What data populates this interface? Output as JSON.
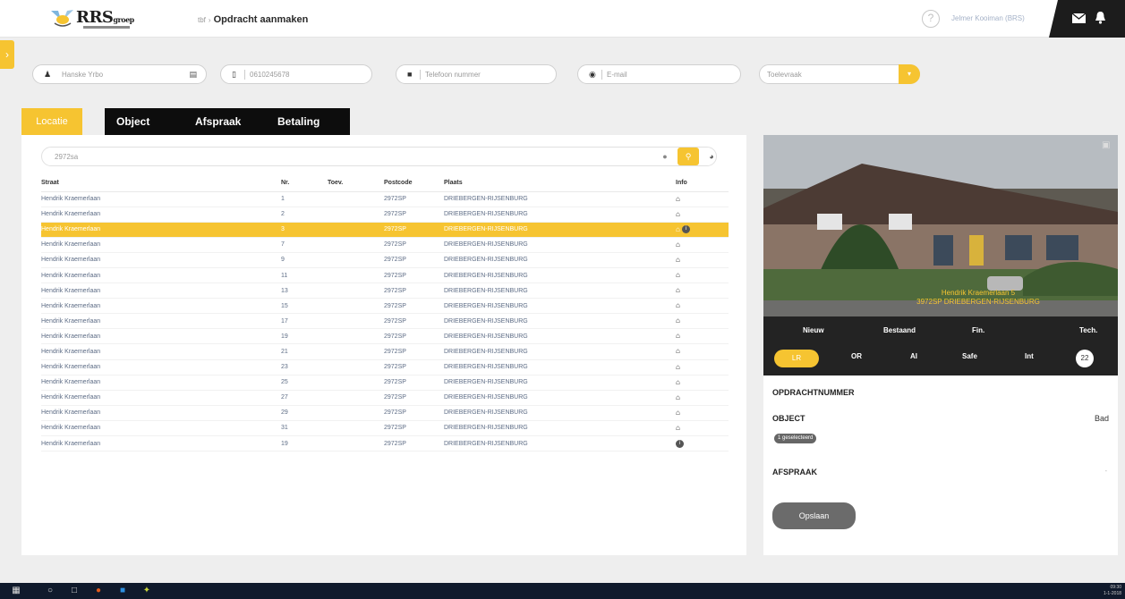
{
  "header": {
    "breadcrumb_root": "tbf",
    "breadcrumb_sep": "›",
    "breadcrumb_current": "Opdracht aanmaken",
    "user_name": "Jelmer Kooiman (BRS)",
    "logo_text": "RRS",
    "logo_small": "groep"
  },
  "topfields": {
    "name": "Hanske Yrbo",
    "phone": "0610245678",
    "phone2_placeholder": "Telefoon nummer",
    "email_placeholder": "E-mail",
    "select_value": "Toelevraak"
  },
  "tabs": [
    {
      "label": "Locatie"
    },
    {
      "label": "Object"
    },
    {
      "label": "Afspraak"
    },
    {
      "label": "Betaling"
    }
  ],
  "filter": {
    "value": "2972sa"
  },
  "table": {
    "headers": {
      "straat": "Straat",
      "nr": "Nr.",
      "toev": "Toev.",
      "postcode": "Postcode",
      "plaats": "Plaats",
      "info": "Info"
    },
    "rows": [
      {
        "straat": "Hendrik Kraemerlaan",
        "nr": "1",
        "postcode": "2972SP",
        "plaats": "DRIEBERGEN-RIJSENBURG",
        "info": "house"
      },
      {
        "straat": "Hendrik Kraemerlaan",
        "nr": "2",
        "postcode": "2972SP",
        "plaats": "DRIEBERGEN-RIJSENBURG",
        "info": "house"
      },
      {
        "straat": "Hendrik Kraemerlaan",
        "nr": "3",
        "postcode": "2972SP",
        "plaats": "DRIEBERGEN-RIJSENBURG",
        "info": "house-dot",
        "selected": true
      },
      {
        "straat": "Hendrik Kraemerlaan",
        "nr": "7",
        "postcode": "2972SP",
        "plaats": "DRIEBERGEN-RIJSENBURG",
        "info": "house"
      },
      {
        "straat": "Hendrik Kraemerlaan",
        "nr": "9",
        "postcode": "2972SP",
        "plaats": "DRIEBERGEN-RIJSENBURG",
        "info": "house"
      },
      {
        "straat": "Hendrik Kraemerlaan",
        "nr": "11",
        "postcode": "2972SP",
        "plaats": "DRIEBERGEN-RIJSENBURG",
        "info": "house"
      },
      {
        "straat": "Hendrik Kraemerlaan",
        "nr": "13",
        "postcode": "2972SP",
        "plaats": "DRIEBERGEN-RIJSENBURG",
        "info": "house"
      },
      {
        "straat": "Hendrik Kraemerlaan",
        "nr": "15",
        "postcode": "2972SP",
        "plaats": "DRIEBERGEN-RIJSENBURG",
        "info": "house"
      },
      {
        "straat": "Hendrik Kraemerlaan",
        "nr": "17",
        "postcode": "2972SP",
        "plaats": "DRIEBERGEN-RIJSENBURG",
        "info": "house"
      },
      {
        "straat": "Hendrik Kraemerlaan",
        "nr": "19",
        "postcode": "2972SP",
        "plaats": "DRIEBERGEN-RIJSENBURG",
        "info": "house"
      },
      {
        "straat": "Hendrik Kraemerlaan",
        "nr": "21",
        "postcode": "2972SP",
        "plaats": "DRIEBERGEN-RIJSENBURG",
        "info": "house"
      },
      {
        "straat": "Hendrik Kraemerlaan",
        "nr": "23",
        "postcode": "2972SP",
        "plaats": "DRIEBERGEN-RIJSENBURG",
        "info": "house"
      },
      {
        "straat": "Hendrik Kraemerlaan",
        "nr": "25",
        "postcode": "2972SP",
        "plaats": "DRIEBERGEN-RIJSENBURG",
        "info": "house"
      },
      {
        "straat": "Hendrik Kraemerlaan",
        "nr": "27",
        "postcode": "2972SP",
        "plaats": "DRIEBERGEN-RIJSENBURG",
        "info": "house"
      },
      {
        "straat": "Hendrik Kraemerlaan",
        "nr": "29",
        "postcode": "2972SP",
        "plaats": "DRIEBERGEN-RIJSENBURG",
        "info": "house"
      },
      {
        "straat": "Hendrik Kraemerlaan",
        "nr": "31",
        "postcode": "2972SP",
        "plaats": "DRIEBERGEN-RIJSENBURG",
        "info": "house"
      },
      {
        "straat": "Hendrik Kraemerlaan",
        "nr": "19",
        "postcode": "2972SP",
        "plaats": "DRIEBERGEN-RIJSENBURG",
        "info": "dot"
      }
    ]
  },
  "photo": {
    "address_line1": "Hendrik Kraemerlaan 5",
    "address_line2": "3972SP DRIEBERGEN-RIJSENBURG"
  },
  "categories": [
    {
      "label": "Nieuw"
    },
    {
      "label": "Bestaand"
    },
    {
      "label": "Fin."
    },
    {
      "label": "Tech."
    }
  ],
  "pills": [
    {
      "label": "LR"
    },
    {
      "label": "OR"
    },
    {
      "label": "AI"
    },
    {
      "label": "Safe"
    },
    {
      "label": "Int"
    },
    {
      "label": "22"
    }
  ],
  "sections": {
    "opdrachtnummer": "OPDRACHTNUMMER",
    "object": "OBJECT",
    "object_value": "Bad",
    "object_badge": "1 geselecteerd",
    "afspraak": "AFSPRAAK",
    "afspraak_value": "-",
    "save_label": "Opslaan"
  },
  "taskbar": {
    "time": "09:30",
    "date": "1-1-2018"
  },
  "colors": {
    "accent": "#f6c431",
    "dark": "#0d0d0d",
    "header_dark": "#1c1c1c",
    "taskbar": "#101a2c"
  }
}
